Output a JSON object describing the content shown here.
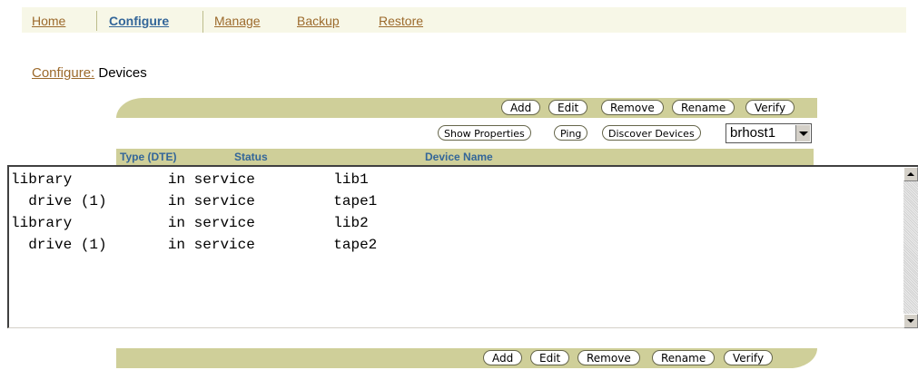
{
  "tabs": [
    {
      "label": "Home",
      "active": false
    },
    {
      "label": "Configure",
      "active": true
    },
    {
      "label": "Manage",
      "active": false
    },
    {
      "label": "Backup",
      "active": false
    },
    {
      "label": "Restore",
      "active": false
    }
  ],
  "breadcrumb": {
    "link": "Configure:",
    "current": " Devices"
  },
  "toolbar": {
    "add": "Add",
    "edit": "Edit",
    "remove": "Remove",
    "rename": "Rename",
    "verify": "Verify",
    "show_properties": "Show Properties",
    "ping": "Ping",
    "discover_devices": "Discover Devices",
    "host_value": "brhost1"
  },
  "columns": {
    "type": "Type (DTE)",
    "status": "Status",
    "device_name": "Device Name"
  },
  "device_list_text": "library           in service         lib1\n  drive (1)       in service         tape1\nlibrary           in service         lib2\n  drive (1)       in service         tape2",
  "colors": {
    "accent": "#336699",
    "link": "#9c6a2c",
    "bar": "#cfcf99"
  }
}
